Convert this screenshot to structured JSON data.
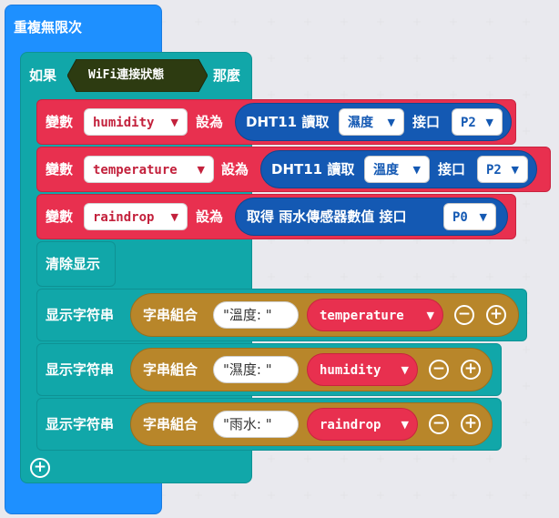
{
  "loop": {
    "label": "重複無限次"
  },
  "if_block": {
    "label_if": "如果",
    "condition": "WiFi連接狀態",
    "label_then": "那麼"
  },
  "set_blocks": [
    {
      "label_set": "變數",
      "variable": "humidity",
      "label_to": "設為",
      "func": "DHT11 讀取",
      "reading": "濕度",
      "label_port": "接口",
      "port": "P2"
    },
    {
      "label_set": "變數",
      "variable": "temperature",
      "label_to": "設為",
      "func": "DHT11 讀取",
      "reading": "溫度",
      "label_port": "接口",
      "port": "P2"
    },
    {
      "label_set": "變數",
      "variable": "raindrop",
      "label_to": "設為",
      "func": "取得 雨水傳感器數值 接口",
      "port": "P0"
    }
  ],
  "clear_block": {
    "label": "清除显示"
  },
  "show_blocks": [
    {
      "label": "显示字符串",
      "join": "字串組合",
      "text": "\"溫度: \"",
      "variable": "temperature"
    },
    {
      "label": "显示字符串",
      "join": "字串組合",
      "text": "\"濕度: \"",
      "variable": "humidity"
    },
    {
      "label": "显示字符串",
      "join": "字串組合",
      "text": "\"雨水: \"",
      "variable": "raindrop"
    }
  ],
  "colors": {
    "loop": "#1e90ff",
    "logic": "#11a7a9",
    "variables": "#e8304f",
    "sensor": "#1459b3",
    "text": "#b8862a"
  },
  "icons": {
    "dropdown": "caret-down-icon",
    "minus": "minus-circle-icon",
    "plus": "plus-circle-icon"
  }
}
